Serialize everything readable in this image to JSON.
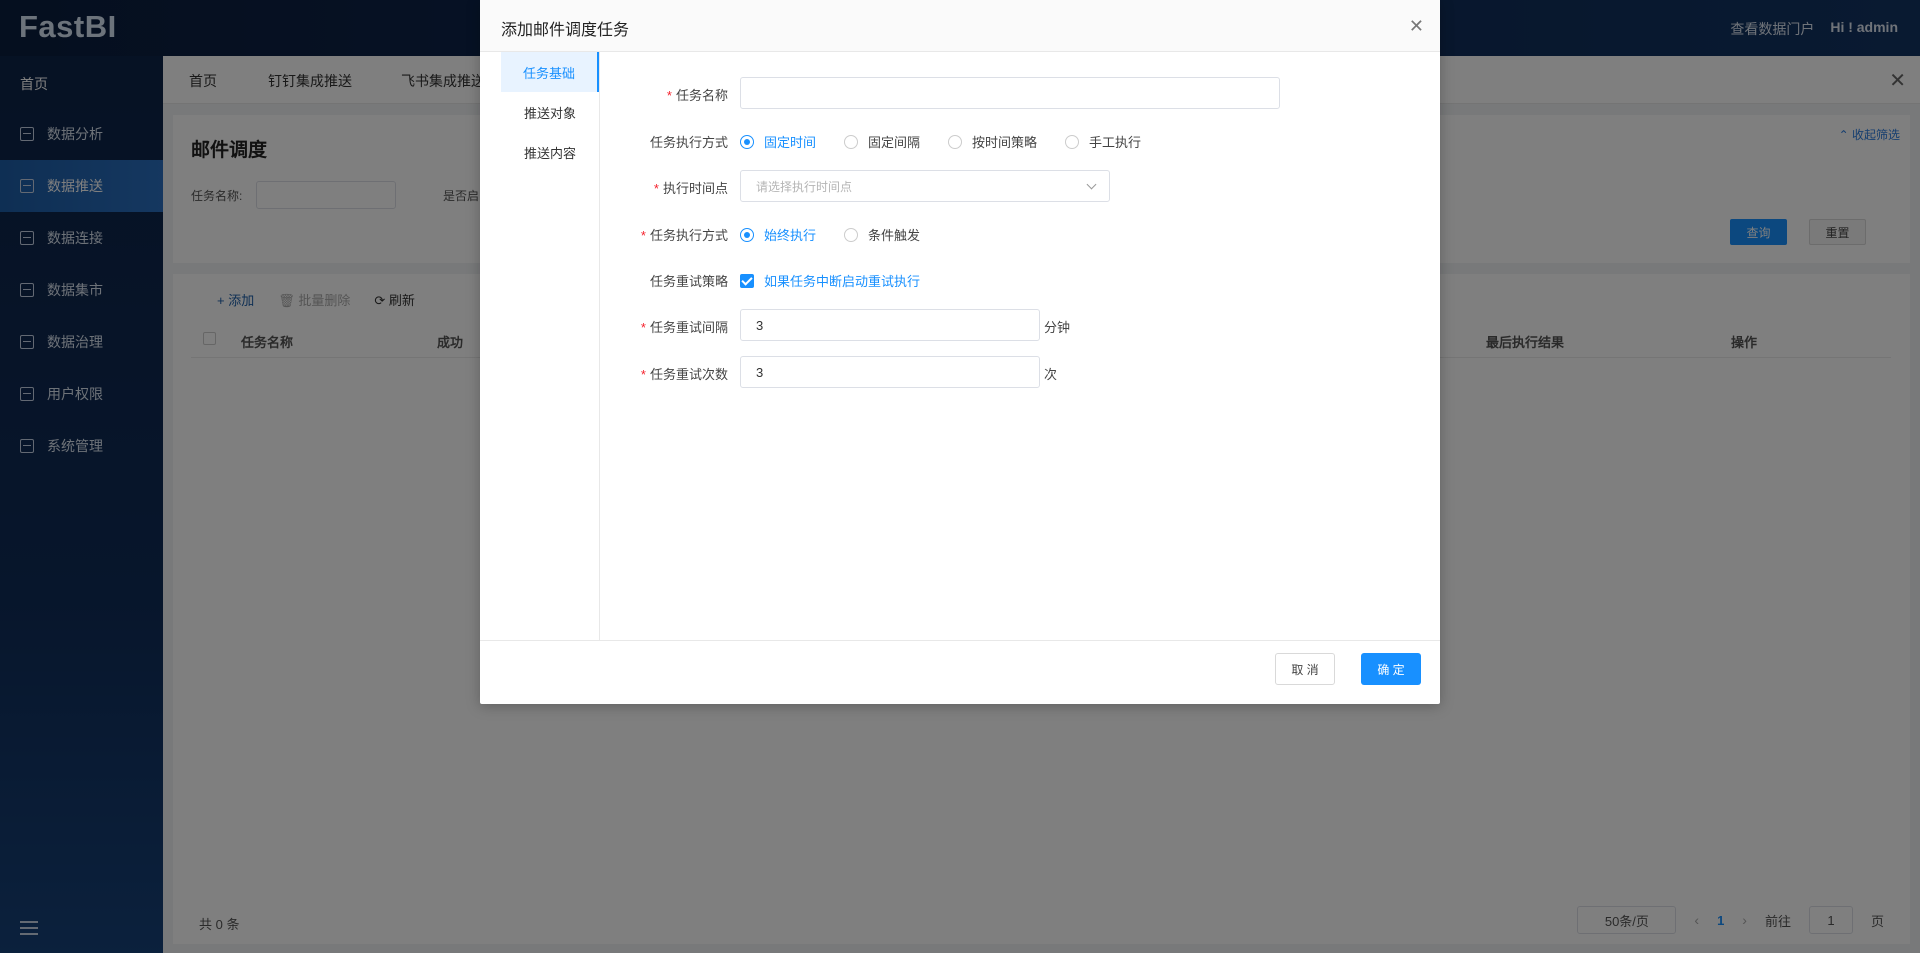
{
  "app": {
    "logo": "FastBI",
    "portal_link": "查看数据门户",
    "user_greeting": "Hi ! admin"
  },
  "sidebar": {
    "home": "首页",
    "items": [
      {
        "label": "数据分析",
        "icon": "analysis-icon"
      },
      {
        "label": "数据推送",
        "icon": "push-icon",
        "active": true
      },
      {
        "label": "数据连接",
        "icon": "connection-icon"
      },
      {
        "label": "数据集市",
        "icon": "mart-icon"
      },
      {
        "label": "数据治理",
        "icon": "governance-icon"
      },
      {
        "label": "用户权限",
        "icon": "user-permission-icon"
      },
      {
        "label": "系统管理",
        "icon": "system-icon"
      }
    ]
  },
  "tabs": [
    "首页",
    "钉钉集成推送",
    "飞书集成推送"
  ],
  "page": {
    "title": "邮件调度",
    "filter_task_name_label": "任务名称:",
    "filter_enabled_label": "是否启",
    "collapse_filter": "收起筛选",
    "query_button": "查询",
    "reset_button": "重置"
  },
  "table": {
    "toolbar": {
      "add": "添加",
      "batch_delete": "批量删除",
      "refresh": "刷新"
    },
    "columns": [
      "任务名称",
      "成功",
      "最后执行结果",
      "操作"
    ],
    "total": "共 0 条",
    "page_size": "50条/页",
    "current_page": "1",
    "goto_label": "前往",
    "goto_value": "1",
    "page_suffix": "页"
  },
  "modal": {
    "title": "添加邮件调度任务",
    "nav": [
      "任务基础",
      "推送对象",
      "推送内容"
    ],
    "fields": {
      "task_name_label": "任务名称",
      "task_name_value": "",
      "exec_mode_label": "任务执行方式",
      "exec_mode_options": [
        "固定时间",
        "固定间隔",
        "按时间策略",
        "手工执行"
      ],
      "exec_mode_selected": "固定时间",
      "exec_time_label": "执行时间点",
      "exec_time_placeholder": "请选择执行时间点",
      "exec_trigger_label": "任务执行方式",
      "exec_trigger_options": [
        "始终执行",
        "条件触发"
      ],
      "exec_trigger_selected": "始终执行",
      "retry_policy_label": "任务重试策略",
      "retry_policy_text": "如果任务中断启动重试执行",
      "retry_policy_checked": true,
      "retry_interval_label": "任务重试间隔",
      "retry_interval_value": "3",
      "retry_interval_unit": "分钟",
      "retry_count_label": "任务重试次数",
      "retry_count_value": "3",
      "retry_count_unit": "次"
    },
    "cancel_button": "取 消",
    "confirm_button": "确 定"
  },
  "colors": {
    "accent": "#1890ff",
    "sidebar_bg": "#0f2c58",
    "required": "#f5222d"
  }
}
